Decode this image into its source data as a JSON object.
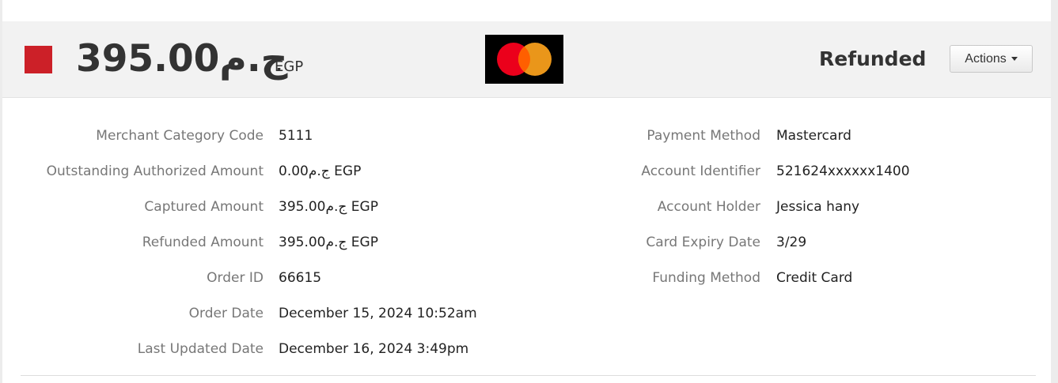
{
  "header": {
    "amount": "395.00ج.م",
    "currency": "EGP",
    "card_brand_icon": "mastercard-logo-icon",
    "status": "Refunded",
    "actions_label": "Actions",
    "colors": {
      "status_indicator": "#cc2028",
      "mc_red": "#eb001b",
      "mc_orange": "#f79e1b"
    }
  },
  "details_left": [
    {
      "label": "Merchant Category Code",
      "value": "5111"
    },
    {
      "label": "Outstanding Authorized Amount",
      "value": "0.00ج.م EGP"
    },
    {
      "label": "Captured Amount",
      "value": "395.00ج.م EGP"
    },
    {
      "label": "Refunded Amount",
      "value": "395.00ج.م EGP"
    },
    {
      "label": "Order ID",
      "value": "66615"
    },
    {
      "label": "Order Date",
      "value": "December 15, 2024 10:52am"
    },
    {
      "label": "Last Updated Date",
      "value": "December 16, 2024 3:49pm"
    }
  ],
  "details_right": [
    {
      "label": "Payment Method",
      "value": "Mastercard"
    },
    {
      "label": "Account Identifier",
      "value": "521624xxxxxx1400"
    },
    {
      "label": "Account Holder",
      "value": "Jessica hany"
    },
    {
      "label": "Card Expiry Date",
      "value": "3/29"
    },
    {
      "label": "Funding Method",
      "value": "Credit Card"
    }
  ]
}
